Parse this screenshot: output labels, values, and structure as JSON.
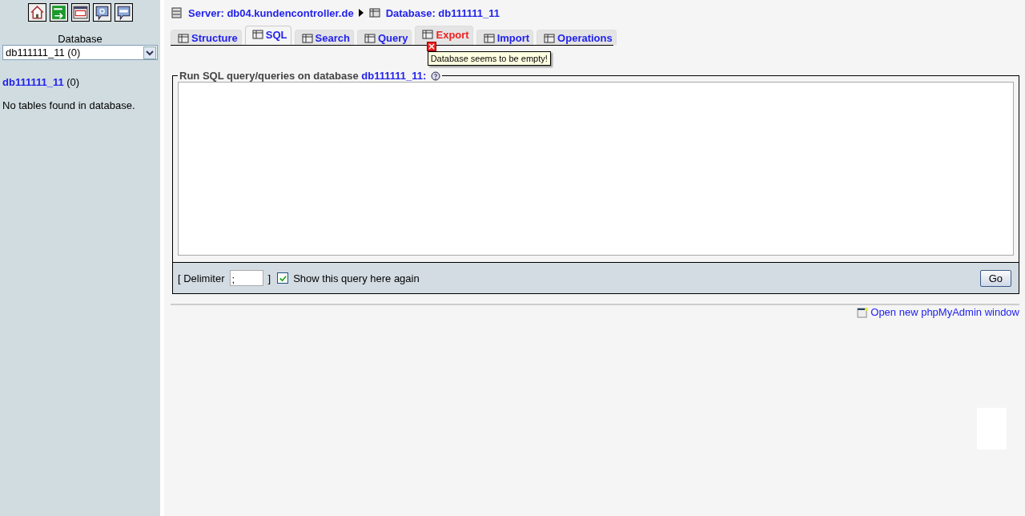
{
  "sidebar": {
    "database_label": "Database",
    "database_select": "db111111_11 (0)",
    "database_link": "db111111_11",
    "database_count": "(0)",
    "message": "No tables found in database."
  },
  "breadcrumb": {
    "server": "Server: db04.kundencontroller.de",
    "database": "Database: db111111_11"
  },
  "tabs": [
    {
      "label": "Structure",
      "selected": false,
      "error": false
    },
    {
      "label": "SQL",
      "selected": true,
      "error": false
    },
    {
      "label": "Search",
      "selected": false,
      "error": false
    },
    {
      "label": "Query",
      "selected": false,
      "error": false
    },
    {
      "label": "Export",
      "selected": false,
      "error": true
    },
    {
      "label": "Import",
      "selected": false,
      "error": false
    },
    {
      "label": "Operations",
      "selected": false,
      "error": false
    }
  ],
  "tooltip": "Database seems to be empty!",
  "query_panel": {
    "legend": "Run SQL query/queries on database",
    "legend_database": "db111111_11:",
    "delimiter_open": "[ Delimiter",
    "delimiter_value": ";",
    "delimiter_close": "]",
    "show_again": {
      "label": "Show this query here again",
      "checked": true
    },
    "go_button": "Go"
  },
  "new_window_link": "Open new phpMyAdmin window"
}
